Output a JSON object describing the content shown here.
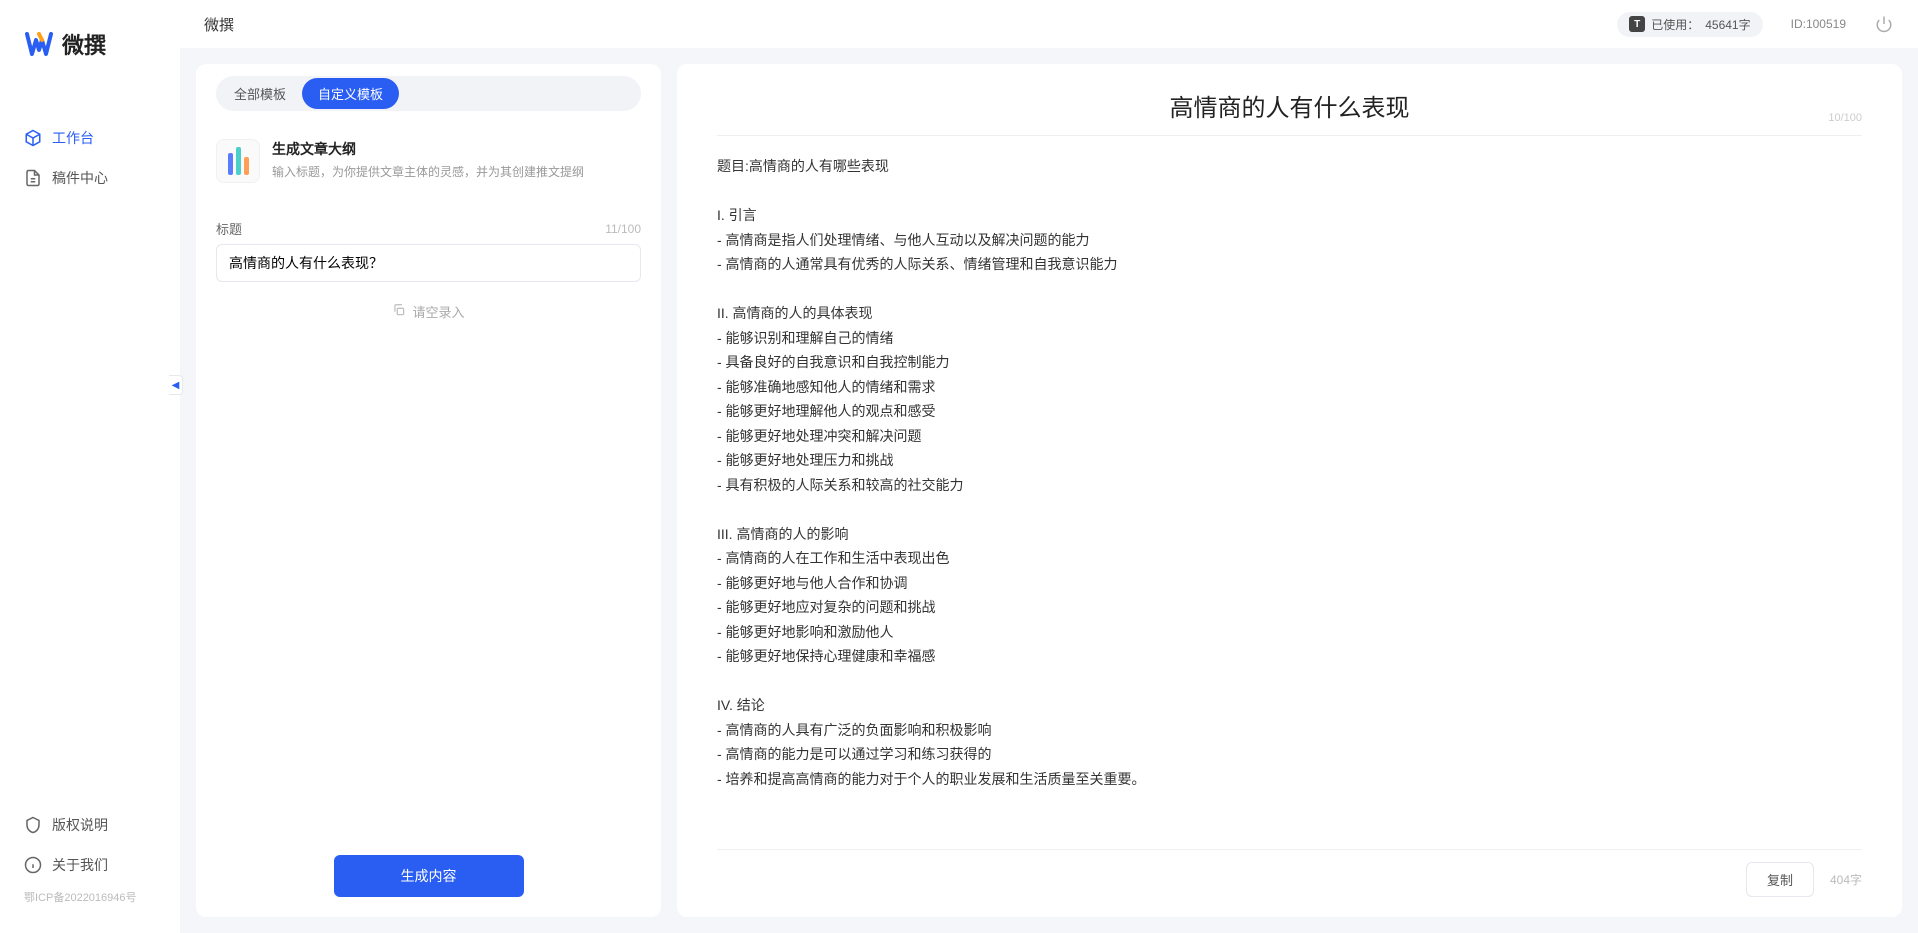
{
  "app_name": "微撰",
  "logo": {
    "text": "微撰"
  },
  "sidebar": {
    "nav": [
      {
        "label": "工作台",
        "icon": "cube-icon",
        "active": true
      },
      {
        "label": "稿件中心",
        "icon": "doc-icon",
        "active": false
      }
    ],
    "bottom": [
      {
        "label": "版权说明",
        "icon": "shield-icon"
      },
      {
        "label": "关于我们",
        "icon": "info-icon"
      }
    ],
    "icp": "鄂ICP备2022016946号"
  },
  "topbar": {
    "usage_label": "已使用：",
    "usage_value": "45641字",
    "user_id": "ID:100519"
  },
  "left_panel": {
    "tabs": [
      {
        "label": "全部模板",
        "active": false
      },
      {
        "label": "自定义模板",
        "active": true
      }
    ],
    "template": {
      "title": "生成文章大纲",
      "desc": "输入标题，为你提供文章主体的灵感，并为其创建推文提纲"
    },
    "title_label": "标题",
    "title_count": "11/100",
    "title_value": "高情商的人有什么表现？",
    "record_hint": "请空录入",
    "generate_label": "生成内容"
  },
  "right_panel": {
    "title": "高情商的人有什么表现",
    "title_meta": "10/100",
    "body": "题目:高情商的人有哪些表现\n\nI. 引言\n- 高情商是指人们处理情绪、与他人互动以及解决问题的能力\n- 高情商的人通常具有优秀的人际关系、情绪管理和自我意识能力\n\nII. 高情商的人的具体表现\n- 能够识别和理解自己的情绪\n- 具备良好的自我意识和自我控制能力\n- 能够准确地感知他人的情绪和需求\n- 能够更好地理解他人的观点和感受\n- 能够更好地处理冲突和解决问题\n- 能够更好地处理压力和挑战\n- 具有积极的人际关系和较高的社交能力\n\nIII. 高情商的人的影响\n- 高情商的人在工作和生活中表现出色\n- 能够更好地与他人合作和协调\n- 能够更好地应对复杂的问题和挑战\n- 能够更好地影响和激励他人\n- 能够更好地保持心理健康和幸福感\n\nIV. 结论\n- 高情商的人具有广泛的负面影响和积极影响\n- 高情商的能力是可以通过学习和练习获得的\n- 培养和提高高情商的能力对于个人的职业发展和生活质量至关重要。",
    "copy_label": "复制",
    "word_count": "404字"
  }
}
